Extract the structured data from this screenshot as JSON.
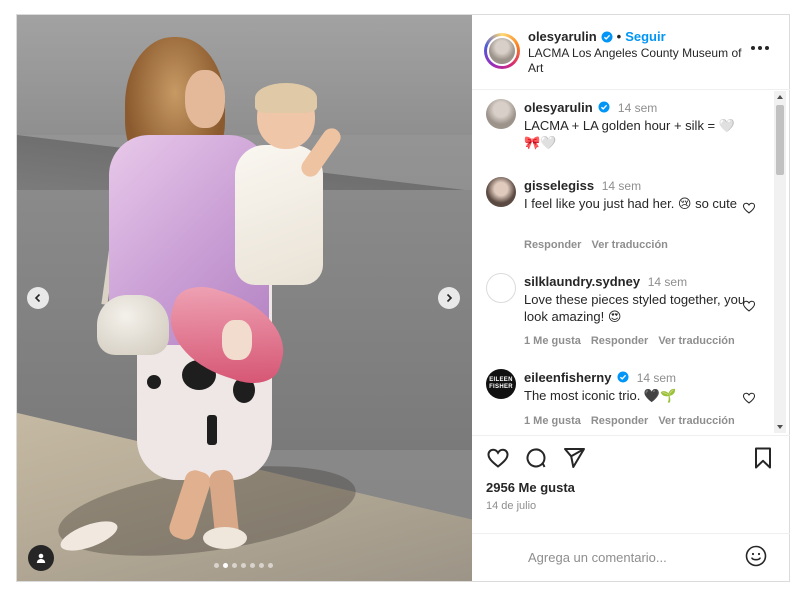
{
  "post": {
    "username": "olesyarulin",
    "follow_label": "Seguir",
    "separator": "•",
    "location": "LACMA Los Angeles County Museum of Art",
    "likes": "2956 Me gusta",
    "date": "14 de julio"
  },
  "caption": {
    "username": "olesyarulin",
    "time": "14 sem",
    "text": "LACMA + LA golden hour + silk = 🤍 🎀🤍"
  },
  "comments": [
    {
      "username": "gisselegiss",
      "time": "14 sem",
      "text": "I feel like you just had her. 😢 so cute",
      "actions": [
        "Responder",
        "Ver traducción"
      ]
    },
    {
      "username": "silklaundry.sydney",
      "time": "14 sem",
      "text": "Love these pieces styled together, you look amazing! 😍",
      "actions": [
        "1 Me gusta",
        "Responder",
        "Ver traducción"
      ]
    },
    {
      "username": "eileenfisherny",
      "time": "14 sem",
      "text": "The most iconic trio. 🖤🌱",
      "actions": [
        "1 Me gusta",
        "Responder",
        "Ver traducción"
      ],
      "avatar_text": [
        "EILEEN",
        "FISHER"
      ]
    }
  ],
  "add_comment": {
    "placeholder": "Agrega un comentario..."
  },
  "carousel": {
    "total": 7,
    "active": 1
  },
  "icons": {
    "verified": "verified-badge-icon",
    "more": "more-options-icon",
    "like": "heart-icon",
    "comment": "comment-icon",
    "share": "share-icon",
    "save": "bookmark-icon",
    "emoji": "emoji-icon",
    "tag": "user-tag-icon",
    "prev": "chevron-left-icon",
    "next": "chevron-right-icon"
  },
  "colors": {
    "accent": "#0095f6",
    "text": "#262626",
    "muted": "#8e8e8e",
    "border": "#dbdbdb"
  }
}
